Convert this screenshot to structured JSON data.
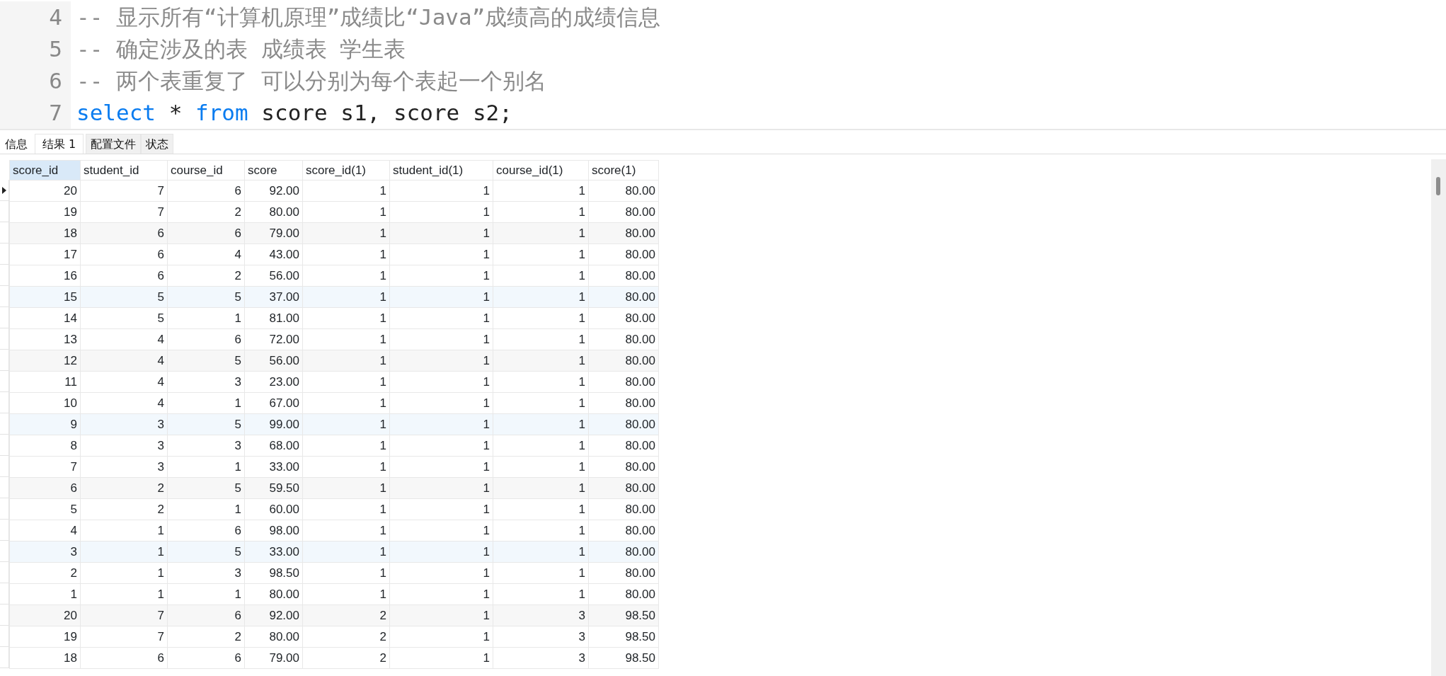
{
  "editor": {
    "lines": [
      {
        "number": "4",
        "kind": "comment",
        "text": "-- 显示所有“计算机原理”成绩比“Java”成绩高的成绩信息"
      },
      {
        "number": "5",
        "kind": "comment",
        "text": "-- 确定涉及的表 成绩表 学生表"
      },
      {
        "number": "6",
        "kind": "comment",
        "text": "-- 两个表重复了 可以分别为每个表起一个别名"
      },
      {
        "number": "7",
        "kind": "code",
        "tokens": [
          {
            "kind": "keyword",
            "text": "select"
          },
          {
            "kind": "plain",
            "text": " * "
          },
          {
            "kind": "keyword",
            "text": "from"
          },
          {
            "kind": "plain",
            "text": " score s1, score s2;"
          }
        ]
      }
    ]
  },
  "tabs": [
    {
      "label": "信息",
      "selected": false
    },
    {
      "label": "结果 1",
      "selected": true
    },
    {
      "label": "配置文件",
      "selected": false
    },
    {
      "label": "状态",
      "selected": false
    }
  ],
  "table": {
    "columns": [
      {
        "label": "score_id",
        "selected": true
      },
      {
        "label": "student_id",
        "selected": false
      },
      {
        "label": "course_id",
        "selected": false
      },
      {
        "label": "score",
        "selected": false
      },
      {
        "label": "score_id(1)",
        "selected": false
      },
      {
        "label": "student_id(1)",
        "selected": false
      },
      {
        "label": "course_id(1)",
        "selected": false
      },
      {
        "label": "score(1)",
        "selected": false
      }
    ],
    "rows": [
      {
        "current": true,
        "cells": [
          "20",
          "7",
          "6",
          "92.00",
          "1",
          "1",
          "1",
          "80.00"
        ]
      },
      {
        "current": false,
        "cells": [
          "19",
          "7",
          "2",
          "80.00",
          "1",
          "1",
          "1",
          "80.00"
        ]
      },
      {
        "current": false,
        "color": "#f7f7f7",
        "cells": [
          "18",
          "6",
          "6",
          "79.00",
          "1",
          "1",
          "1",
          "80.00"
        ]
      },
      {
        "current": false,
        "cells": [
          "17",
          "6",
          "4",
          "43.00",
          "1",
          "1",
          "1",
          "80.00"
        ]
      },
      {
        "current": false,
        "cells": [
          "16",
          "6",
          "2",
          "56.00",
          "1",
          "1",
          "1",
          "80.00"
        ]
      },
      {
        "current": false,
        "color": "#f2f8fd",
        "cells": [
          "15",
          "5",
          "5",
          "37.00",
          "1",
          "1",
          "1",
          "80.00"
        ]
      },
      {
        "current": false,
        "cells": [
          "14",
          "5",
          "1",
          "81.00",
          "1",
          "1",
          "1",
          "80.00"
        ]
      },
      {
        "current": false,
        "cells": [
          "13",
          "4",
          "6",
          "72.00",
          "1",
          "1",
          "1",
          "80.00"
        ]
      },
      {
        "current": false,
        "color": "#f7f7f7",
        "cells": [
          "12",
          "4",
          "5",
          "56.00",
          "1",
          "1",
          "1",
          "80.00"
        ]
      },
      {
        "current": false,
        "cells": [
          "11",
          "4",
          "3",
          "23.00",
          "1",
          "1",
          "1",
          "80.00"
        ]
      },
      {
        "current": false,
        "cells": [
          "10",
          "4",
          "1",
          "67.00",
          "1",
          "1",
          "1",
          "80.00"
        ]
      },
      {
        "current": false,
        "color": "#f2f8fd",
        "cells": [
          "9",
          "3",
          "5",
          "99.00",
          "1",
          "1",
          "1",
          "80.00"
        ]
      },
      {
        "current": false,
        "cells": [
          "8",
          "3",
          "3",
          "68.00",
          "1",
          "1",
          "1",
          "80.00"
        ]
      },
      {
        "current": false,
        "cells": [
          "7",
          "3",
          "1",
          "33.00",
          "1",
          "1",
          "1",
          "80.00"
        ]
      },
      {
        "current": false,
        "color": "#f7f7f7",
        "cells": [
          "6",
          "2",
          "5",
          "59.50",
          "1",
          "1",
          "1",
          "80.00"
        ]
      },
      {
        "current": false,
        "cells": [
          "5",
          "2",
          "1",
          "60.00",
          "1",
          "1",
          "1",
          "80.00"
        ]
      },
      {
        "current": false,
        "cells": [
          "4",
          "1",
          "6",
          "98.00",
          "1",
          "1",
          "1",
          "80.00"
        ]
      },
      {
        "current": false,
        "color": "#f2f8fd",
        "cells": [
          "3",
          "1",
          "5",
          "33.00",
          "1",
          "1",
          "1",
          "80.00"
        ]
      },
      {
        "current": false,
        "cells": [
          "2",
          "1",
          "3",
          "98.50",
          "1",
          "1",
          "1",
          "80.00"
        ]
      },
      {
        "current": false,
        "cells": [
          "1",
          "1",
          "1",
          "80.00",
          "1",
          "1",
          "1",
          "80.00"
        ]
      },
      {
        "current": false,
        "color": "#f7f7f7",
        "cells": [
          "20",
          "7",
          "6",
          "92.00",
          "2",
          "1",
          "3",
          "98.50"
        ]
      },
      {
        "current": false,
        "cells": [
          "19",
          "7",
          "2",
          "80.00",
          "2",
          "1",
          "3",
          "98.50"
        ]
      },
      {
        "current": false,
        "cells": [
          "18",
          "6",
          "6",
          "79.00",
          "2",
          "1",
          "3",
          "98.50"
        ]
      }
    ]
  }
}
